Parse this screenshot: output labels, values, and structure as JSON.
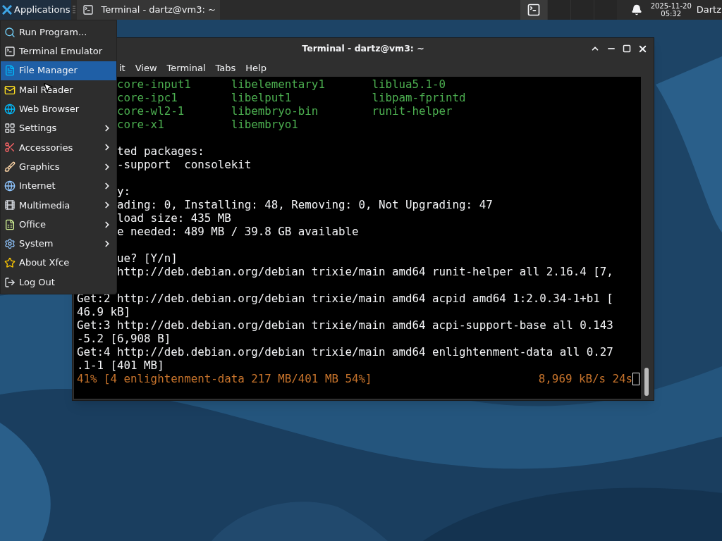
{
  "panel": {
    "applications_label": "Applications",
    "tasks": [
      {
        "title": "Terminal - dartz@vm3: ~",
        "selected": false
      }
    ],
    "clock": {
      "date": "2025-11-20",
      "time": "05:32"
    },
    "user": "Dartz"
  },
  "app_menu": {
    "items": [
      {
        "label": "Run Program...",
        "selected": false,
        "submenu": false
      },
      {
        "label": "Terminal Emulator",
        "selected": false,
        "submenu": false
      },
      {
        "label": "File Manager",
        "selected": true,
        "submenu": false
      },
      {
        "label": "Mail Reader",
        "selected": false,
        "submenu": false
      },
      {
        "label": "Web Browser",
        "selected": false,
        "submenu": false
      },
      {
        "label": "Settings",
        "selected": false,
        "submenu": true
      },
      {
        "label": "Accessories",
        "selected": false,
        "submenu": true
      },
      {
        "label": "Graphics",
        "selected": false,
        "submenu": true
      },
      {
        "label": "Internet",
        "selected": false,
        "submenu": true
      },
      {
        "label": "Multimedia",
        "selected": false,
        "submenu": true
      },
      {
        "label": "Office",
        "selected": false,
        "submenu": true
      },
      {
        "label": "System",
        "selected": false,
        "submenu": true
      },
      {
        "label": "About Xfce",
        "selected": false,
        "submenu": false
      },
      {
        "label": "Log Out",
        "selected": false,
        "submenu": false
      }
    ]
  },
  "terminal": {
    "title": "Terminal - dartz@vm3: ~",
    "menu": [
      "it",
      "View",
      "Terminal",
      "Tabs",
      "Help"
    ],
    "lines": [
      {
        "kind": "package",
        "text": "core-input1      libelementary1       liblua5.1-0"
      },
      {
        "kind": "package",
        "text": "core-ipc1        libelput1            libpam-fprintd"
      },
      {
        "kind": "package",
        "text": "core-wl2-1       libembryo-bin        runit-helper"
      },
      {
        "kind": "package",
        "text": "core-x1          libembryo1"
      },
      {
        "kind": "blank"
      },
      {
        "kind": "clipped",
        "text": "ted packages:"
      },
      {
        "kind": "clipped",
        "text": "-support  consolekit"
      },
      {
        "kind": "blank"
      },
      {
        "kind": "clipped",
        "text": "y:"
      },
      {
        "kind": "clipped",
        "text": "ading: 0, Installing: 48, Removing: 0, Not Upgrading: 47"
      },
      {
        "kind": "clipped",
        "text": "load size: 435 MB"
      },
      {
        "kind": "clipped",
        "text": "e needed: 489 MB / 39.8 GB available"
      },
      {
        "kind": "blank"
      },
      {
        "kind": "clipped",
        "text": "ue? [Y/n]"
      },
      {
        "kind": "clipped",
        "text": "http://deb.debian.org/debian trixie/main amd64 runit-helper all 2.16.4 [7,"
      },
      {
        "kind": "blank"
      },
      {
        "kind": "plain",
        "text": "Get:2 http://deb.debian.org/debian trixie/main amd64 acpid amd64 1:2.0.34-1+b1 ["
      },
      {
        "kind": "plain",
        "text": "46.9 kB]"
      },
      {
        "kind": "plain",
        "text": "Get:3 http://deb.debian.org/debian trixie/main amd64 acpi-support-base all 0.143"
      },
      {
        "kind": "plain",
        "text": "-5.2 [6,908 B]"
      },
      {
        "kind": "plain",
        "text": "Get:4 http://deb.debian.org/debian trixie/main amd64 enlightenment-data all 0.27"
      },
      {
        "kind": "plain",
        "text": ".1-1 [401 MB]"
      },
      {
        "kind": "progress",
        "text": "41% [4 enlightenment-data 217 MB/401 MB 54%]",
        "rate": "8,969 kB/s 24s"
      }
    ]
  }
}
